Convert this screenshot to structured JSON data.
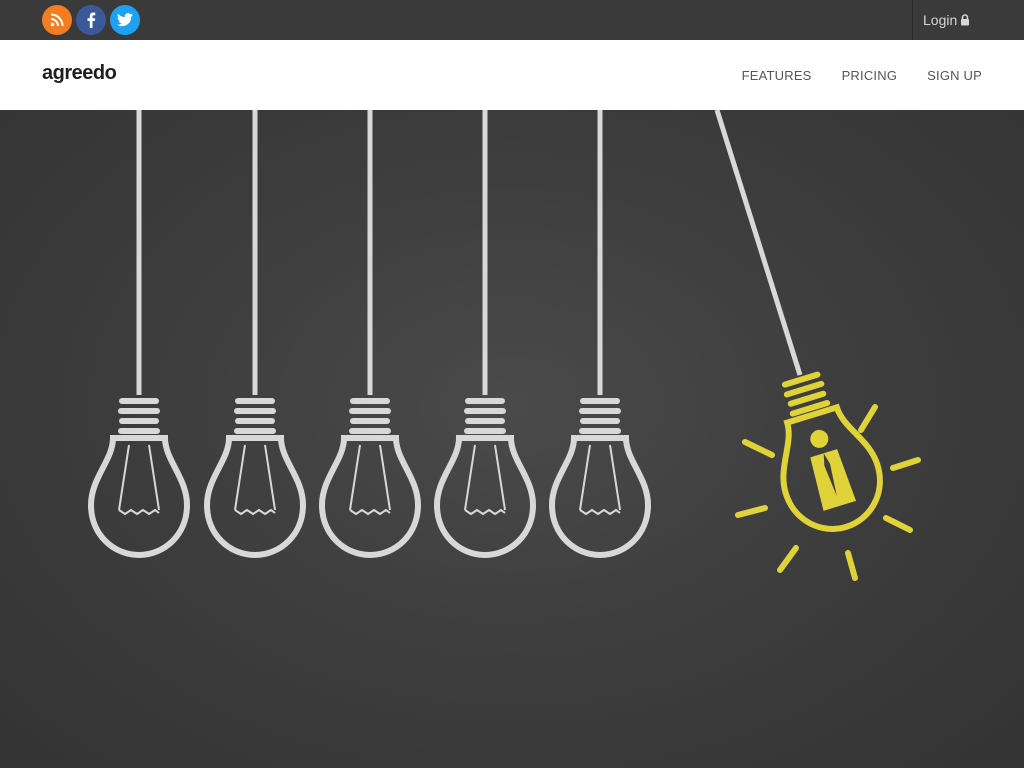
{
  "topbar": {
    "social": [
      {
        "name": "rss-icon",
        "color": "#f57c1f"
      },
      {
        "name": "facebook-icon",
        "color": "#3b5998"
      },
      {
        "name": "twitter-icon",
        "color": "#1da1f2"
      }
    ],
    "login_label": "Login",
    "login_icon": "lock-icon"
  },
  "navbar": {
    "logo_text": "agreedo",
    "nav_items": [
      "FEATURES",
      "PRICING",
      "SIGN UP"
    ]
  },
  "hero": {
    "image_description_icons": [
      "lightbulb-icon",
      "lit-lightbulb-icon"
    ],
    "accent_color": "#e0d33a"
  }
}
